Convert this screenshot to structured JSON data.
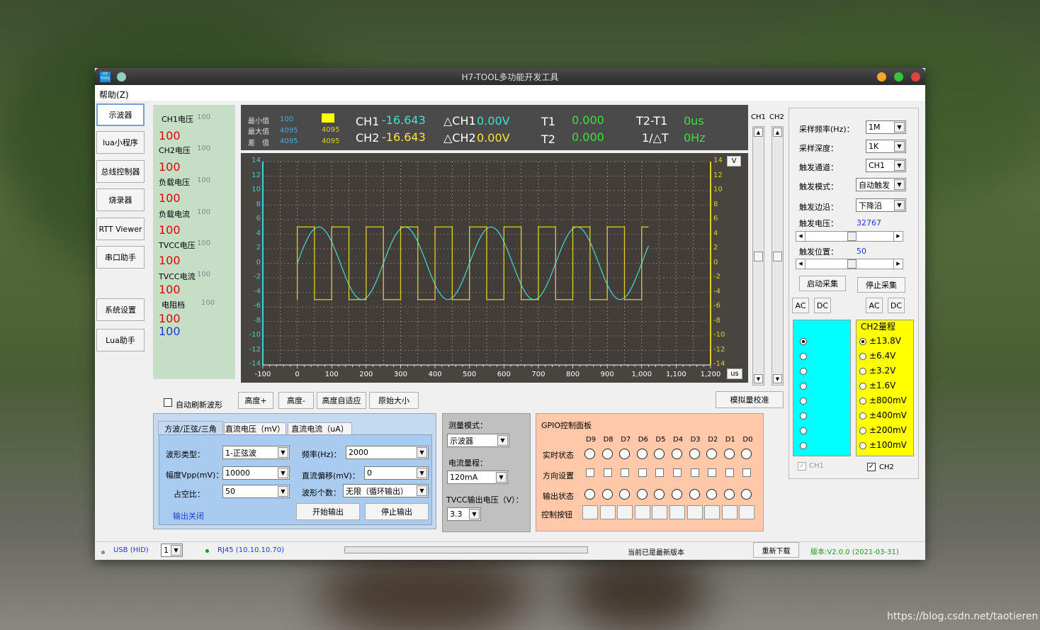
{
  "window": {
    "title": "H7-TOOL多功能开发工具",
    "icon_text": "H7\nTOOL"
  },
  "menu": {
    "help": "帮助(Z)"
  },
  "nav": [
    "示波器",
    "lua小程序",
    "总线控制器",
    "烧录器",
    "RTT Viewer",
    "串口助手",
    "系统设置",
    "Lua助手"
  ],
  "meters": [
    {
      "label": "CH1电压",
      "sub": "100",
      "value": "100"
    },
    {
      "label": "CH2电压",
      "sub": "100",
      "value": "100"
    },
    {
      "label": "负载电压",
      "sub": "100",
      "value": "100"
    },
    {
      "label": "负载电流",
      "sub": "100",
      "value": "100"
    },
    {
      "label": "TVCC电压",
      "sub": "100",
      "value": "100"
    },
    {
      "label": "TVCC电流",
      "sub": "100",
      "value": "100"
    },
    {
      "label": "电阻档",
      "sub": "100",
      "value": "100",
      "value2": "100"
    }
  ],
  "stats": {
    "min_label": "最小值",
    "max_label": "最大值",
    "diff_label": "差　值",
    "ch1_min": "100",
    "ch1_max": "4095",
    "ch1_diff": "4095",
    "ch2_max": "4095",
    "ch2_diff": "4095",
    "ch1_label": "CH1",
    "ch1_value": "-16.643",
    "ch2_label": "CH2",
    "ch2_value": "-16.643",
    "dch1_label": "△CH1",
    "dch1_value": "0.00V",
    "dch2_label": "△CH2",
    "dch2_value": "0.00V",
    "t1_label": "T1",
    "t1_value": "0.000",
    "t2_label": "T2",
    "t2_value": "0.000",
    "dt_label": "T2-T1",
    "dt_value": "0us",
    "inv_label": "1/△T",
    "inv_value": "0Hz"
  },
  "chart_data": {
    "type": "line",
    "x_ticks": [
      "-100",
      "0",
      "100",
      "200",
      "300",
      "400",
      "500",
      "600",
      "700",
      "800",
      "900",
      "1,000",
      "1,100",
      "1,200"
    ],
    "y_ticks": [
      "14",
      "12",
      "10",
      "8",
      "6",
      "4",
      "2",
      "0",
      "-2",
      "-4",
      "-6",
      "-8",
      "-10",
      "-12",
      "-14"
    ],
    "xlim": [
      -100,
      1200
    ],
    "ylim": [
      -14,
      14
    ],
    "xunit": "us",
    "yunit": "V",
    "grid": true,
    "series": [
      {
        "color": "#3fd0d0",
        "kind": "sine",
        "amplitude": 5,
        "offset": 0,
        "period": 250,
        "x_start": 0,
        "x_end": 1020
      },
      {
        "color": "#e0d020",
        "kind": "square",
        "high": 5,
        "low": -5,
        "period": 100,
        "duty": 0.5,
        "x_start": 0,
        "x_end": 1020
      }
    ]
  },
  "scope_buttons": {
    "auto_refresh": "自动刷新波形",
    "height_plus": "高度+",
    "height_minus": "高度-",
    "height_auto": "高度自适应",
    "original": "原始大小",
    "calibrate": "模拟量校准"
  },
  "side": {
    "ch1": "CH1",
    "ch2": "CH2"
  },
  "settings": {
    "rate_label": "采样频率(Hz)：",
    "rate": "1M",
    "depth_label": "采样深度：",
    "depth": "1K",
    "channel_label": "触发通道：",
    "channel": "CH1",
    "mode_label": "触发模式：",
    "mode": "自动触发",
    "edge_label": "触发边沿：",
    "edge": "下降沿",
    "level_label": "触发电压：",
    "level": "32767",
    "pos_label": "触发位置：",
    "pos": "50",
    "start": "启动采集",
    "stop": "停止采集",
    "ac": "AC",
    "dc": "DC"
  },
  "range": {
    "ch2_title": "CH2量程",
    "ch2_options": [
      "±13.8V",
      "±6.4V",
      "±3.2V",
      "±1.6V",
      "±800mV",
      "±400mV",
      "±200mV",
      "±100mV"
    ],
    "ch1_check": "CH1",
    "ch2_check": "CH2"
  },
  "generator": {
    "tabs": [
      "方波/正弦/三角",
      "直流电压（mV）",
      "直流电流（uA）"
    ],
    "wave_label": "波形类型：",
    "wave": "1-正弦波",
    "freq_label": "频率(Hz)：",
    "freq": "2000",
    "vpp_label": "幅度Vpp(mV)：",
    "vpp": "10000",
    "offset_label": "直流偏移(mV)：",
    "offset": "0",
    "duty_label": "占空比：",
    "duty": "50",
    "count_label": "波形个数：",
    "count": "无限（循环输出）",
    "status": "输出关闭",
    "start": "开始输出",
    "stop": "停止输出"
  },
  "measure": {
    "mode_label": "测量模式：",
    "mode": "示波器",
    "range_label": "电流量程：",
    "range": "120mA",
    "tvcc_label": "TVCC输出电压（V）：",
    "tvcc": "3.3"
  },
  "gpio": {
    "title": "GPIO控制面板",
    "pins": [
      "D9",
      "D8",
      "D7",
      "D6",
      "D5",
      "D4",
      "D3",
      "D2",
      "D1",
      "D0"
    ],
    "row_state": "实时状态",
    "row_dir": "方向设置",
    "row_out": "输出状态",
    "row_ctrl": "控制按钮"
  },
  "status": {
    "usb": "USB (HID)",
    "port": "1",
    "rj45": "RJ45 (10.10.10.70)",
    "version_msg": "当前已是最新版本",
    "redownload": "重新下载",
    "version": "版本:V2.0.0 (2021-03-31)"
  },
  "watermark": "https://blog.csdn.net/taotieren"
}
